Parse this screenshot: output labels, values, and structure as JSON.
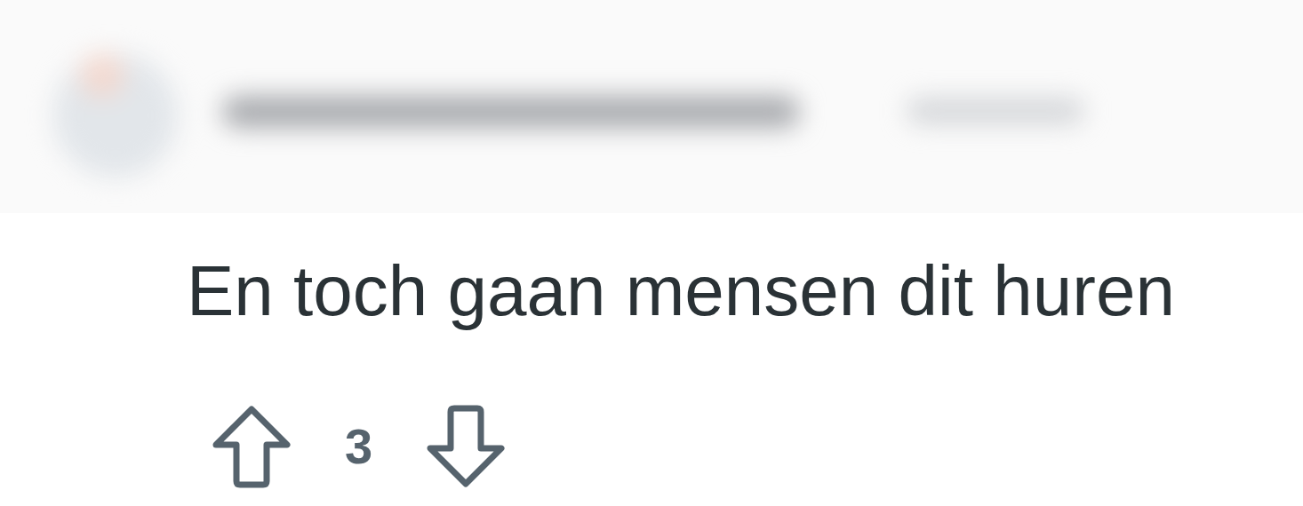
{
  "comment": {
    "text": "En toch gaan mensen dit huren"
  },
  "votes": {
    "score": "3"
  }
}
